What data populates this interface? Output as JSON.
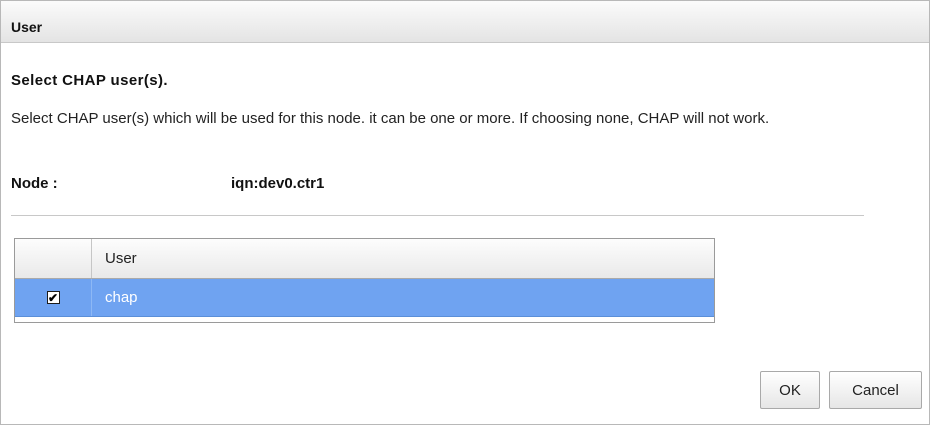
{
  "dialog": {
    "title": "User",
    "heading": "Select CHAP user(s).",
    "description": "Select CHAP user(s) which will be used for this node. it can be one or more. If choosing none, CHAP will not work.",
    "node_label": "Node :",
    "node_value": "iqn:dev0.ctr1"
  },
  "grid": {
    "columns": [
      "",
      "User"
    ],
    "rows": [
      {
        "checked": true,
        "check_glyph": "✔",
        "user": "chap"
      }
    ],
    "selected_row_color": "#6fa3f1"
  },
  "buttons": {
    "ok_label": "OK",
    "cancel_label": "Cancel"
  }
}
